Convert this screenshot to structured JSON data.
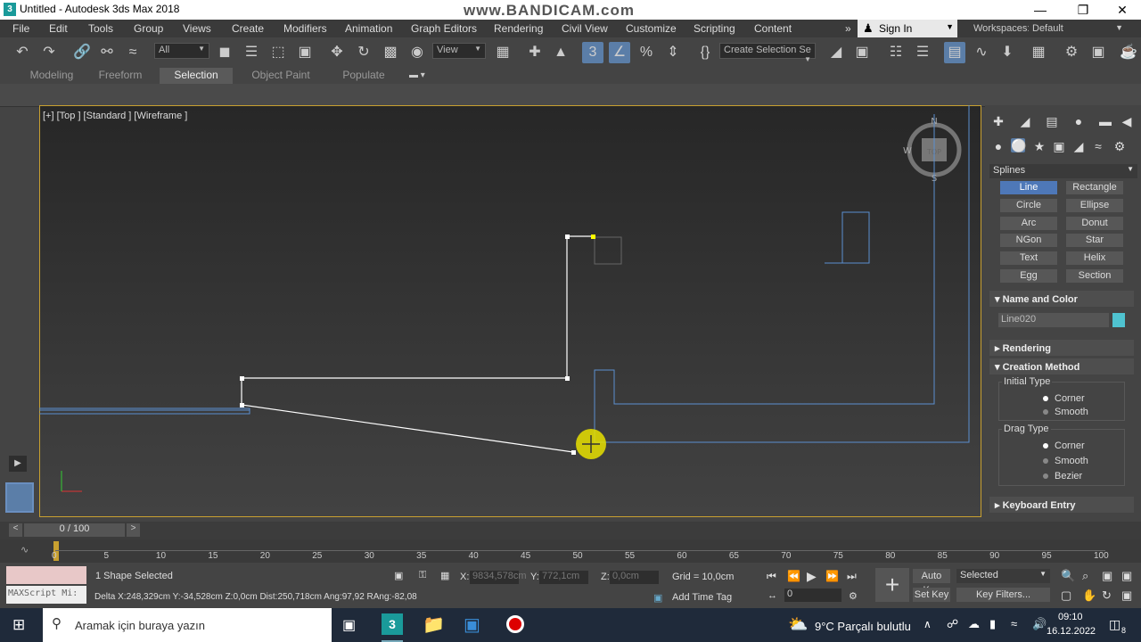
{
  "window": {
    "title": "Untitled - Autodesk 3ds Max 2018",
    "watermark": "www.BANDICAM.com",
    "logo": "3"
  },
  "menu": [
    "File",
    "Edit",
    "Tools",
    "Group",
    "Views",
    "Create",
    "Modifiers",
    "Animation",
    "Graph Editors",
    "Rendering",
    "Civil View",
    "Customize",
    "Scripting",
    "Content"
  ],
  "signin": "Sign In",
  "workspaces": {
    "label": "Workspaces:",
    "value": "Default"
  },
  "toolbar": {
    "filter": "All",
    "ref_coord": "View",
    "selection_set": "Create Selection Se"
  },
  "ribbon_tabs": [
    "Modeling",
    "Freeform",
    "Selection",
    "Object Paint",
    "Populate"
  ],
  "viewport": {
    "label": "[+] [Top ] [Standard ] [Wireframe ]",
    "compass": {
      "n": "N",
      "w": "W",
      "s": "S",
      "center": "TOP"
    }
  },
  "command_panel": {
    "category": "Splines",
    "buttons": [
      "Line",
      "Rectangle",
      "Circle",
      "Ellipse",
      "Arc",
      "Donut",
      "NGon",
      "Star",
      "Text",
      "Helix",
      "Egg",
      "Section"
    ],
    "name_color": {
      "header": "Name and Color",
      "name": "Line020",
      "color": "#4fc3d0"
    },
    "rendering": "Rendering",
    "creation_method": {
      "header": "Creation Method",
      "initial_type": {
        "label": "Initial Type",
        "options": [
          "Corner",
          "Smooth"
        ],
        "selected": "Corner"
      },
      "drag_type": {
        "label": "Drag Type",
        "options": [
          "Corner",
          "Smooth",
          "Bezier"
        ],
        "selected": "Corner"
      }
    },
    "keyboard_entry": "Keyboard Entry"
  },
  "time": {
    "slider": "0 / 100",
    "ticks": [
      "0",
      "5",
      "10",
      "15",
      "20",
      "25",
      "30",
      "35",
      "40",
      "45",
      "50",
      "55",
      "60",
      "65",
      "70",
      "75",
      "80",
      "85",
      "90",
      "95",
      "100"
    ]
  },
  "status": {
    "selected": "1 Shape Selected",
    "prompt": "Delta X:248,329cm  Y:-34,528cm  Z:0,0cm  Dist:250,718cm  Ang:97,92  RAng:-82,08",
    "maxscript": "MAXScript Mi:",
    "x_label": "X:",
    "x": "9834,578cm",
    "y_label": "Y:",
    "y": "772,1cm",
    "z_label": "Z:",
    "z": "0,0cm",
    "grid": "Grid = 10,0cm",
    "add_time_tag": "Add Time Tag",
    "auto_key": "Auto Key",
    "selected_dd": "Selected",
    "set_key": "Set Key",
    "key_filters": "Key Filters...",
    "frame": "0"
  },
  "taskbar": {
    "search": "Aramak için buraya yazın",
    "weather": "9°C  Parçalı bulutlu",
    "time": "09:10",
    "date": "16.12.2022",
    "notifications": "8"
  }
}
